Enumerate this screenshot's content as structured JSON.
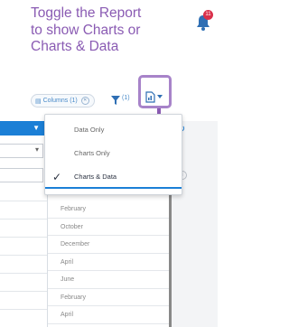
{
  "callout": {
    "lines": [
      "Toggle the Report",
      "to show Charts or",
      "Charts & Data"
    ]
  },
  "notifications": {
    "icon": "bell-icon",
    "badge": "11"
  },
  "toolbar": {
    "columns_label": "Columns (1)",
    "columns_icon": "columns-icon",
    "filter_icon": "filter-icon",
    "filter_count": "(1)",
    "report_view_icon": "report-chart-icon",
    "more_icon": "more-dots-icon"
  },
  "report_menu": {
    "items": [
      {
        "label": "Data Only",
        "selected": false
      },
      {
        "label": "Charts Only",
        "selected": false
      },
      {
        "label": "Charts & Data",
        "selected": true
      }
    ]
  },
  "months": [
    "February",
    "October",
    "December",
    "April",
    "June",
    "February",
    "April"
  ],
  "colors": {
    "callout_text": "#8a5bb3",
    "highlight_border": "#a783c9",
    "accent_blue": "#1b7fd6",
    "badge_red": "#d9304a"
  }
}
